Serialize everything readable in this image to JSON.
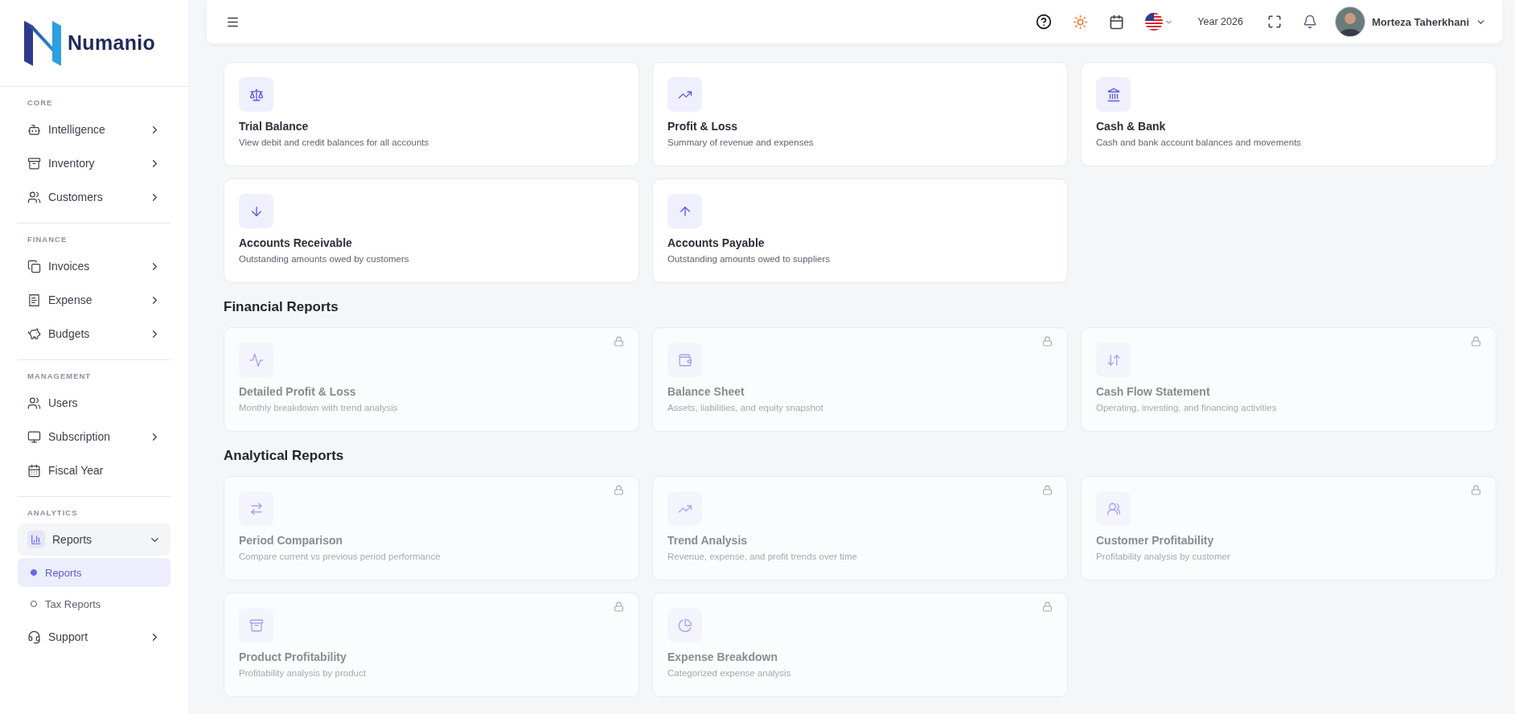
{
  "brand": {
    "name": "Numanio"
  },
  "sidebar": {
    "sections": [
      {
        "label": "CORE",
        "items": [
          {
            "label": "Intelligence",
            "expanded": false
          },
          {
            "label": "Inventory",
            "expanded": false
          },
          {
            "label": "Customers",
            "expanded": false
          }
        ]
      },
      {
        "label": "FINANCE",
        "items": [
          {
            "label": "Invoices",
            "expanded": false
          },
          {
            "label": "Expense",
            "expanded": false
          },
          {
            "label": "Budgets",
            "expanded": false
          }
        ]
      },
      {
        "label": "MANAGEMENT",
        "items": [
          {
            "label": "Users"
          },
          {
            "label": "Subscription",
            "expanded": false
          },
          {
            "label": "Fiscal Year"
          }
        ]
      },
      {
        "label": "ANALYTICS",
        "items": [
          {
            "label": "Reports",
            "expanded": true,
            "children": [
              {
                "label": "Reports",
                "selected": true
              },
              {
                "label": "Tax Reports",
                "selected": false
              }
            ]
          },
          {
            "label": "Support",
            "expanded": false
          }
        ]
      }
    ]
  },
  "topbar": {
    "year": "Year 2026",
    "user": "Morteza Taherkhani"
  },
  "sections": [
    {
      "cards": [
        {
          "title": "Trial Balance",
          "description": "View debit and credit balances for all accounts",
          "locked": false
        },
        {
          "title": "Profit & Loss",
          "description": "Summary of revenue and expenses",
          "locked": false
        },
        {
          "title": "Cash & Bank",
          "description": "Cash and bank account balances and movements",
          "locked": false
        },
        {
          "title": "Accounts Receivable",
          "description": "Outstanding amounts owed by customers",
          "locked": false
        },
        {
          "title": "Accounts Payable",
          "description": "Outstanding amounts owed to suppliers",
          "locked": false
        }
      ]
    },
    {
      "title": "Financial Reports",
      "cards": [
        {
          "title": "Detailed Profit & Loss",
          "description": "Monthly breakdown with trend analysis",
          "locked": true
        },
        {
          "title": "Balance Sheet",
          "description": "Assets, liabilities, and equity snapshot",
          "locked": true
        },
        {
          "title": "Cash Flow Statement",
          "description": "Operating, investing, and financing activities",
          "locked": true
        }
      ]
    },
    {
      "title": "Analytical Reports",
      "cards": [
        {
          "title": "Period Comparison",
          "description": "Compare current vs previous period performance",
          "locked": true
        },
        {
          "title": "Trend Analysis",
          "description": "Revenue, expense, and profit trends over time",
          "locked": true
        },
        {
          "title": "Customer Profitability",
          "description": "Profitability analysis by customer",
          "locked": true
        },
        {
          "title": "Product Profitability",
          "description": "Profitability analysis by product",
          "locked": true
        },
        {
          "title": "Expense Breakdown",
          "description": "Categorized expense analysis",
          "locked": true
        }
      ]
    }
  ]
}
